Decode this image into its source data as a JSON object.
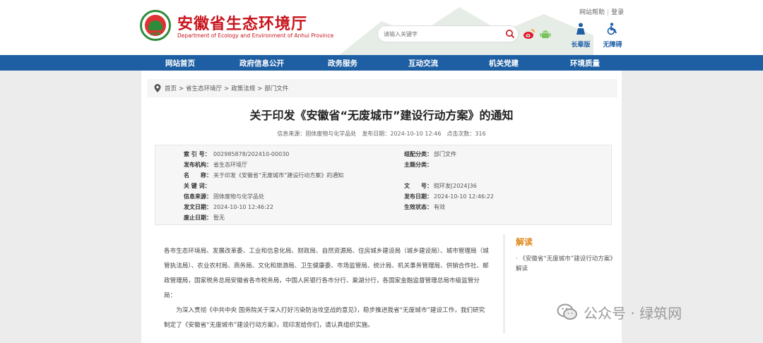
{
  "header": {
    "site_title": "安徽省生态环境厅",
    "site_subtitle": "Department of Ecology and Environment of Anhui Province",
    "logo_text": "AHB",
    "search_placeholder": "请输入关键字",
    "top_links": [
      "网站帮助",
      "登录"
    ],
    "tools": [
      {
        "label": "长辈版",
        "icon": "elder-icon"
      },
      {
        "label": "无障碍",
        "icon": "accessibility-icon"
      }
    ]
  },
  "nav": {
    "items": [
      "网站首页",
      "政府信息公开",
      "政务服务",
      "互动交流",
      "机关党建",
      "环境质量"
    ]
  },
  "breadcrumb": [
    "首页",
    "省生态环境厅",
    "政策法规",
    "部门文件"
  ],
  "article": {
    "title": "关于印发《安徽省“无废城市”建设行动方案》的通知",
    "meta": {
      "source_label": "信息来源：",
      "source": "固体废物与化学品处",
      "date_label": "发布日期：",
      "date": "2024-10-10 12:46",
      "clicks_label": "点击次数：",
      "clicks": "316"
    }
  },
  "info": {
    "left": [
      {
        "label": "索 引 号：",
        "value": "002985878/202410-00030"
      },
      {
        "label": "发布机构：",
        "value": "省生态环境厅"
      },
      {
        "label": "名　　称：",
        "value": "关于印发《安徽省“无废城市”建设行动方案》的通知"
      },
      {
        "label": "关 键 词：",
        "value": ""
      },
      {
        "label": "信息来源：",
        "value": "固体废物与化学品处"
      },
      {
        "label": "发文日期：",
        "value": "2024-10-10 12:46:22"
      },
      {
        "label": "废止日期：",
        "value": "暂无"
      }
    ],
    "right": [
      {
        "label": "组配分类：",
        "value": "部门文件"
      },
      {
        "label": "主题分类：",
        "value": ""
      },
      {
        "label": "文　　号：",
        "value": "皖环发[2024]36"
      },
      {
        "label": "发布日期：",
        "value": "2024-10-10 12:46:22"
      },
      {
        "label": "生效状态：",
        "value": "有效"
      }
    ]
  },
  "body": {
    "para1": "各市生态环境局、发展改革委、工业和信息化局、财政局、自然资源局、住房城乡建设局（城乡建设局）、城市管理局（城管执法局）、农业农村局、商务局、文化和旅游局、卫生健康委、市场监管局、统计局、机关事务管理局、供销合作社、邮政管理局，国家税务总局安徽省各市税务局，中国人民银行各市分行、巢湖分行，各国家金融监督管理总局市级监管分局：",
    "para2": "为深入贯彻《中共中央 国务院关于深入打好污染防治攻坚战的意见》，稳步推进我省“无废城市”建设工作，我们研究制定了《安徽省“无废城市”建设行动方案》，现印发给你们，请认真组织实施。"
  },
  "sidebar": {
    "title": "解读",
    "item": "《安徽省“无废城市”建设行动方案》解读"
  },
  "watermark": {
    "text": "公众号 · 绿筑网"
  },
  "colors": {
    "brand_red": "#c8151d",
    "nav_blue": "#1e5fa3",
    "accent_orange": "#e08a1e"
  }
}
